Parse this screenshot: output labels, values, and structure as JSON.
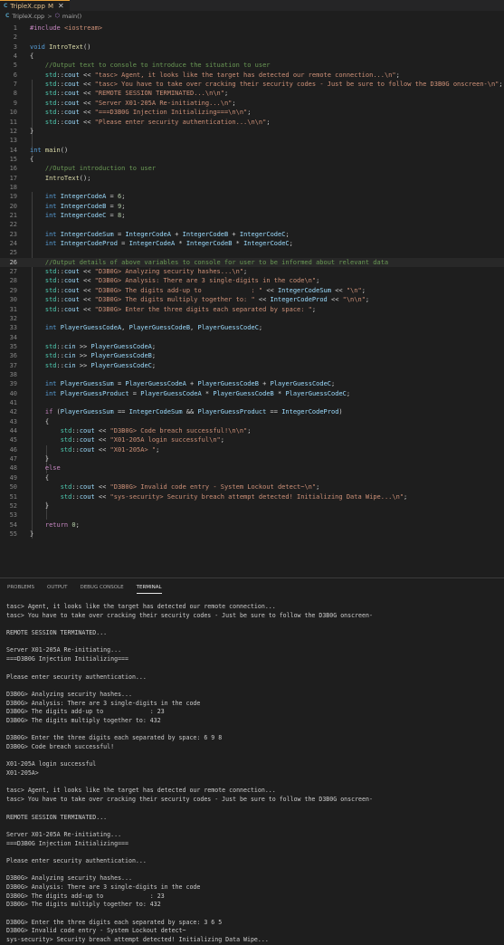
{
  "tab": {
    "filename": "TripleX.cpp",
    "modified": "M",
    "close": "✕"
  },
  "breadcrumb": {
    "file": "TripleX.cpp",
    "separator": ">",
    "symbol": "main()"
  },
  "editor": {
    "lines": [
      {
        "n": "1",
        "html": "<span class='pp'>#include</span> <span class='str'>&lt;iostream&gt;</span>"
      },
      {
        "n": "2",
        "html": ""
      },
      {
        "n": "3",
        "html": "<span class='kw'>void</span> <span class='fn'>IntroText</span>()"
      },
      {
        "n": "4",
        "html": "{"
      },
      {
        "n": "5",
        "html": "    <span class='cm'>//Output text to console to introduce the situation to user</span>"
      },
      {
        "n": "6",
        "html": "    <span class='ty'>std</span>::<span class='var'>cout</span> &lt;&lt; <span class='str'>\"tasc&gt; Agent, it looks like the target has detected our remote connection...\\n\"</span>;"
      },
      {
        "n": "7",
        "html": "    <span class='ty'>std</span>::<span class='var'>cout</span> &lt;&lt; <span class='str'>\"tasc&gt; You have to take over cracking their security codes - Just be sure to follow the D3B0G onscreen-\\n\"</span>;"
      },
      {
        "n": "8",
        "html": "    <span class='ty'>std</span>::<span class='var'>cout</span> &lt;&lt; <span class='str'>\"REMOTE SESSION TERMINATED...\\n\\n\"</span>;"
      },
      {
        "n": "9",
        "html": "    <span class='ty'>std</span>::<span class='var'>cout</span> &lt;&lt; <span class='str'>\"Server X01-205A Re-initiating...\\n\"</span>;"
      },
      {
        "n": "10",
        "html": "    <span class='ty'>std</span>::<span class='var'>cout</span> &lt;&lt; <span class='str'>\"===D3B0G Injection Initializing===\\n\\n\"</span>;"
      },
      {
        "n": "11",
        "html": "    <span class='ty'>std</span>::<span class='var'>cout</span> &lt;&lt; <span class='str'>\"Please enter security authentication...\\n\\n\"</span>;"
      },
      {
        "n": "12",
        "html": "}"
      },
      {
        "n": "13",
        "html": ""
      },
      {
        "n": "14",
        "html": "<span class='kw'>int</span> <span class='fn'>main</span>()"
      },
      {
        "n": "15",
        "html": "{"
      },
      {
        "n": "16",
        "html": "    <span class='cm'>//Output introduction to user</span>"
      },
      {
        "n": "17",
        "html": "    <span class='fn'>IntroText</span>();"
      },
      {
        "n": "18",
        "html": ""
      },
      {
        "n": "19",
        "html": "    <span class='kw'>int</span> <span class='var'>IntegerCodeA</span> = <span class='num-lit'>6</span>;"
      },
      {
        "n": "20",
        "html": "    <span class='kw'>int</span> <span class='var'>IntegerCodeB</span> = <span class='num-lit'>9</span>;"
      },
      {
        "n": "21",
        "html": "    <span class='kw'>int</span> <span class='var'>IntegerCodeC</span> = <span class='num-lit'>8</span>;"
      },
      {
        "n": "22",
        "html": ""
      },
      {
        "n": "23",
        "html": "    <span class='kw'>int</span> <span class='var'>IntegerCodeSum</span> = <span class='var'>IntegerCodeA</span> + <span class='var'>IntegerCodeB</span> + <span class='var'>IntegerCodeC</span>;"
      },
      {
        "n": "24",
        "html": "    <span class='kw'>int</span> <span class='var'>IntegerCodeProd</span> = <span class='var'>IntegerCodeA</span> * <span class='var'>IntegerCodeB</span> * <span class='var'>IntegerCodeC</span>;"
      },
      {
        "n": "25",
        "html": ""
      },
      {
        "n": "26",
        "html": "    <span class='cm'>//Output details of above variables to console for user to be informed about relevant data</span>"
      },
      {
        "n": "27",
        "html": "    <span class='ty'>std</span>::<span class='var'>cout</span> &lt;&lt; <span class='str'>\"D3B0G&gt; Analyzing security hashes...\\n\"</span>;"
      },
      {
        "n": "28",
        "html": "    <span class='ty'>std</span>::<span class='var'>cout</span> &lt;&lt; <span class='str'>\"D3B0G&gt; Analysis: There are 3 single-digits in the code\\n\"</span>;"
      },
      {
        "n": "29",
        "html": "    <span class='ty'>std</span>::<span class='var'>cout</span> &lt;&lt; <span class='str'>\"D3B0G&gt; The digits add-up to             : \"</span> &lt;&lt; <span class='var'>IntegerCodeSum</span> &lt;&lt; <span class='str'>\"\\n\"</span>;"
      },
      {
        "n": "30",
        "html": "    <span class='ty'>std</span>::<span class='var'>cout</span> &lt;&lt; <span class='str'>\"D3B0G&gt; The digits multiply together to: \"</span> &lt;&lt; <span class='var'>IntegerCodeProd</span> &lt;&lt; <span class='str'>\"\\n\\n\"</span>;"
      },
      {
        "n": "31",
        "html": "    <span class='ty'>std</span>::<span class='var'>cout</span> &lt;&lt; <span class='str'>\"D3B0G&gt; Enter the three digits each separated by space: \"</span>;"
      },
      {
        "n": "32",
        "html": ""
      },
      {
        "n": "33",
        "html": "    <span class='kw'>int</span> <span class='var'>PlayerGuessCodeA</span>, <span class='var'>PlayerGuessCodeB</span>, <span class='var'>PlayerGuessCodeC</span>;"
      },
      {
        "n": "34",
        "html": ""
      },
      {
        "n": "35",
        "html": "    <span class='ty'>std</span>::<span class='var'>cin</span> &gt;&gt; <span class='var'>PlayerGuessCodeA</span>;"
      },
      {
        "n": "36",
        "html": "    <span class='ty'>std</span>::<span class='var'>cin</span> &gt;&gt; <span class='var'>PlayerGuessCodeB</span>;"
      },
      {
        "n": "37",
        "html": "    <span class='ty'>std</span>::<span class='var'>cin</span> &gt;&gt; <span class='var'>PlayerGuessCodeC</span>;"
      },
      {
        "n": "38",
        "html": ""
      },
      {
        "n": "39",
        "html": "    <span class='kw'>int</span> <span class='var'>PlayerGuessSum</span> = <span class='var'>PlayerGuessCodeA</span> + <span class='var'>PlayerGuessCodeB</span> + <span class='var'>PlayerGuessCodeC</span>;"
      },
      {
        "n": "40",
        "html": "    <span class='kw'>int</span> <span class='var'>PlayerGuessProduct</span> = <span class='var'>PlayerGuessCodeA</span> * <span class='var'>PlayerGuessCodeB</span> * <span class='var'>PlayerGuessCodeC</span>;"
      },
      {
        "n": "41",
        "html": ""
      },
      {
        "n": "42",
        "html": "    <span class='ctl'>if</span> (<span class='var'>PlayerGuessSum</span> == <span class='var'>IntegerCodeSum</span> &amp;&amp; <span class='var'>PlayerGuessProduct</span> == <span class='var'>IntegerCodeProd</span>)"
      },
      {
        "n": "43",
        "html": "    {"
      },
      {
        "n": "44",
        "html": "        <span class='ty'>std</span>::<span class='var'>cout</span> &lt;&lt; <span class='str'>\"D3B0G&gt; Code breach successful!\\n\\n\"</span>;"
      },
      {
        "n": "45",
        "html": "        <span class='ty'>std</span>::<span class='var'>cout</span> &lt;&lt; <span class='str'>\"X01-205A login successful\\n\"</span>;"
      },
      {
        "n": "46",
        "html": "        <span class='ty'>std</span>::<span class='var'>cout</span> &lt;&lt; <span class='str'>\"X01-205A&gt; \"</span>;"
      },
      {
        "n": "47",
        "html": "    }"
      },
      {
        "n": "48",
        "html": "    <span class='ctl'>else</span>"
      },
      {
        "n": "49",
        "html": "    {"
      },
      {
        "n": "50",
        "html": "        <span class='ty'>std</span>::<span class='var'>cout</span> &lt;&lt; <span class='str'>\"D3B0G&gt; Invalid code entry - System Lockout detect~\\n\"</span>;"
      },
      {
        "n": "51",
        "html": "        <span class='ty'>std</span>::<span class='var'>cout</span> &lt;&lt; <span class='str'>\"sys-security&gt; Security breach attempt detected! Initializing Data Wipe...\\n\"</span>;"
      },
      {
        "n": "52",
        "html": "    }"
      },
      {
        "n": "53",
        "html": ""
      },
      {
        "n": "54",
        "html": "    <span class='ctl'>return</span> <span class='num-lit'>0</span>;"
      },
      {
        "n": "55",
        "html": "}"
      }
    ]
  },
  "panel": {
    "tabs": [
      "PROBLEMS",
      "OUTPUT",
      "DEBUG CONSOLE",
      "TERMINAL"
    ],
    "active_tab": "TERMINAL"
  },
  "terminal": {
    "lines": [
      "tasc> Agent, it looks like the target has detected our remote connection...",
      "tasc> You have to take over cracking their security codes - Just be sure to follow the D3B0G onscreen-",
      "",
      "REMOTE SESSION TERMINATED...",
      "",
      "Server X01-205A Re-initiating...",
      "===D3B0G Injection Initializing===",
      "",
      "Please enter security authentication...",
      "",
      "D3B0G> Analyzing security hashes...",
      "D3B0G> Analysis: There are 3 single-digits in the code",
      "D3B0G> The digits add-up to             : 23",
      "D3B0G> The digits multiply together to: 432",
      "",
      "D3B0G> Enter the three digits each separated by space: 6 9 8",
      "D3B0G> Code breach successful!",
      "",
      "X01-205A login successful",
      "X01-205A>",
      "",
      "tasc> Agent, it looks like the target has detected our remote connection...",
      "tasc> You have to take over cracking their security codes - Just be sure to follow the D3B0G onscreen-",
      "",
      "REMOTE SESSION TERMINATED...",
      "",
      "Server X01-205A Re-initiating...",
      "===D3B0G Injection Initializing===",
      "",
      "Please enter security authentication...",
      "",
      "D3B0G> Analyzing security hashes...",
      "D3B0G> Analysis: There are 3 single-digits in the code",
      "D3B0G> The digits add-up to             : 23",
      "D3B0G> The digits multiply together to: 432",
      "",
      "D3B0G> Enter the three digits each separated by space: 3 6 5",
      "D3B0G> Invalid code entry - System Lockout detect~",
      "sys-security> Security breach attempt detected! Initializing Data Wipe..."
    ]
  },
  "colors": {
    "accent": "#e8a23a",
    "background": "#1e1e1e"
  }
}
